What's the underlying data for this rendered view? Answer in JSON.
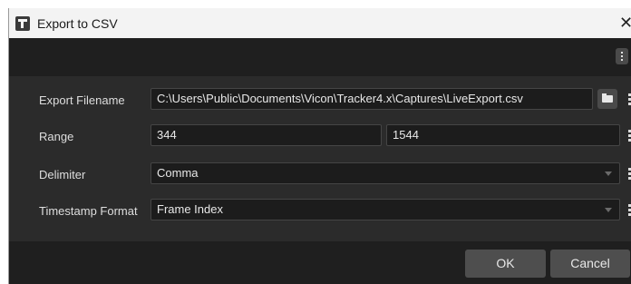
{
  "window": {
    "title": "Export to CSV",
    "close_glyph": "✕"
  },
  "form": {
    "filename": {
      "label": "Export Filename",
      "value": "C:\\Users\\Public\\Documents\\Vicon\\Tracker4.x\\Captures\\LiveExport.csv"
    },
    "range": {
      "label": "Range",
      "start": "344",
      "end": "1544"
    },
    "delimiter": {
      "label": "Delimiter",
      "value": "Comma"
    },
    "timestamp_format": {
      "label": "Timestamp Format",
      "value": "Frame Index"
    }
  },
  "footer": {
    "ok_label": "OK",
    "cancel_label": "Cancel"
  },
  "icons": {
    "app": "app-icon",
    "close": "close-icon",
    "menu": "kebab-menu-icon",
    "browse": "folder-open-icon",
    "dropdown": "chevron-down-icon"
  },
  "colors": {
    "window_bg": "#2b2b2b",
    "strip_bg": "#1f1f1f",
    "field_bg": "#1c1c1c",
    "button_bg": "#4e4e4e",
    "titlebar_bg": "#f3f3f3"
  }
}
